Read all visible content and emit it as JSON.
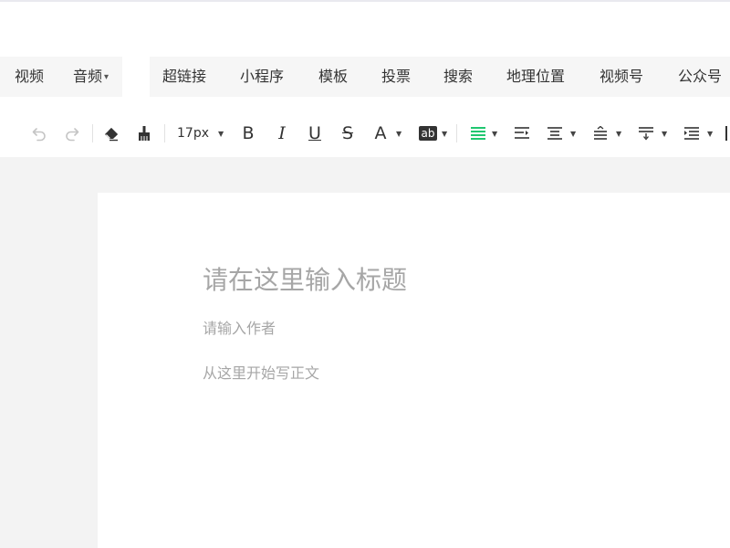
{
  "insert_menu": {
    "items": [
      {
        "label": "视频"
      },
      {
        "label": "音频"
      },
      {
        "label": "超链接"
      },
      {
        "label": "小程序"
      },
      {
        "label": "模板"
      },
      {
        "label": "投票"
      },
      {
        "label": "搜索"
      },
      {
        "label": "地理位置"
      },
      {
        "label": "视频号"
      },
      {
        "label": "公众号"
      }
    ]
  },
  "toolbar": {
    "font_size": "17px",
    "bold": "B",
    "italic": "I",
    "underline": "U",
    "strikethrough": "S",
    "font_color": "A",
    "background_color": "ab",
    "accent_color": "#07c160",
    "icons": [
      "undo-icon",
      "redo-icon",
      "eraser-icon",
      "format-painter-icon",
      "align-justify-icon",
      "indent-icon",
      "align-center-icon",
      "line-height-icon",
      "paragraph-spacing-icon",
      "list-indent-icon"
    ]
  },
  "editor": {
    "title_placeholder": "请在这里输入标题",
    "author_placeholder": "请输入作者",
    "body_placeholder": "从这里开始写正文"
  }
}
